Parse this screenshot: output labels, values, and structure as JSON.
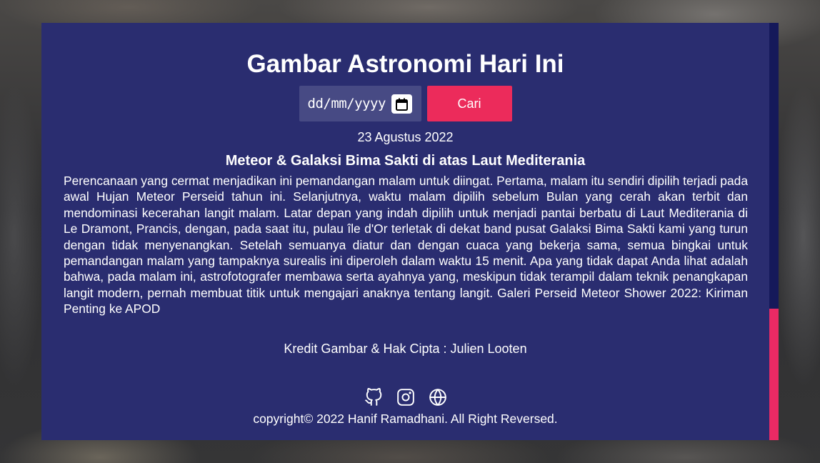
{
  "header": {
    "title": "Gambar Astronomi Hari Ini"
  },
  "search": {
    "date_placeholder": "dd/mm/yyyy",
    "button_label": "Cari"
  },
  "apod": {
    "date": "23 Agustus 2022",
    "title": "Meteor & Galaksi Bima Sakti di atas Laut Mediterania",
    "explanation": "Perencanaan yang cermat menjadikan ini pemandangan malam untuk diingat. Pertama, malam itu sendiri dipilih terjadi pada awal Hujan Meteor Perseid tahun ini. Selanjutnya, waktu malam dipilih sebelum Bulan yang cerah akan terbit dan mendominasi kecerahan langit malam. Latar depan yang indah dipilih untuk menjadi pantai berbatu di Laut Mediterania di Le Dramont, Prancis, dengan, pada saat itu, pulau île d'Or terletak di dekat band pusat Galaksi Bima Sakti kami yang turun dengan tidak menyenangkan. Setelah semuanya diatur dan dengan cuaca yang bekerja sama, semua bingkai untuk pemandangan malam yang tampaknya surealis ini diperoleh dalam waktu 15 menit. Apa yang tidak dapat Anda lihat adalah bahwa, pada malam ini, astrofotografer membawa serta ayahnya yang, meskipun tidak terampil dalam teknik penangkapan langit modern, pernah membuat titik untuk mengajari anaknya tentang langit. Galeri Perseid Meteor Shower 2022: Kiriman Penting ke APOD",
    "credit": "Kredit Gambar & Hak Cipta : Julien Looten"
  },
  "footer": {
    "icons": [
      "github-icon",
      "instagram-icon",
      "globe-icon"
    ],
    "copyright": "copyright© 2022 Hanif Ramadhani. All Right Reversed."
  },
  "colors": {
    "card_background": "#2a2d70",
    "input_background": "#474a84",
    "accent": "#ec2b5b",
    "scrollbar_track": "#15195a",
    "text": "#ffffff"
  }
}
